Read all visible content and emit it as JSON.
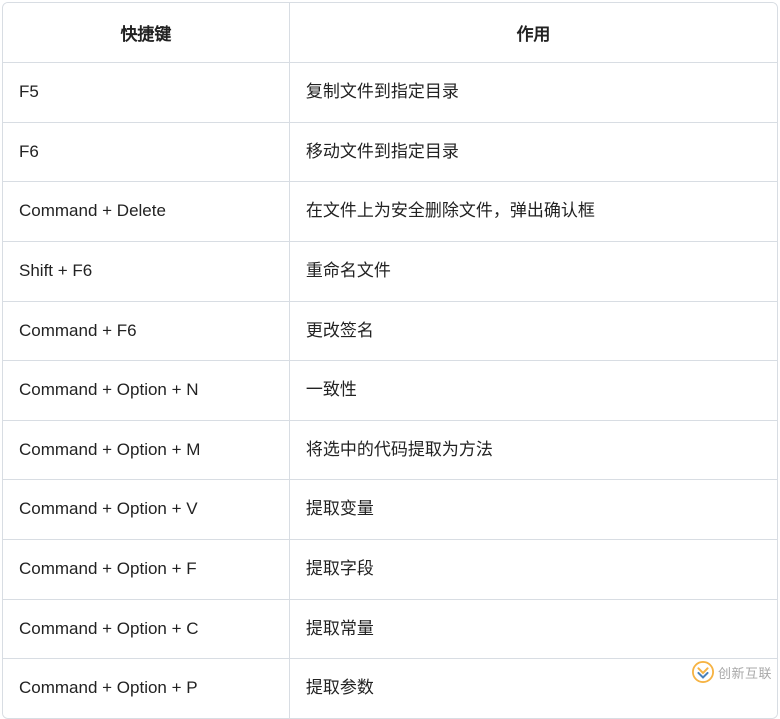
{
  "table": {
    "headers": {
      "shortcut": "快捷键",
      "action": "作用"
    },
    "rows": [
      {
        "shortcut": "F5",
        "action": "复制文件到指定目录"
      },
      {
        "shortcut": "F6",
        "action": "移动文件到指定目录"
      },
      {
        "shortcut": "Command + Delete",
        "action": "在文件上为安全删除文件，弹出确认框"
      },
      {
        "shortcut": "Shift + F6",
        "action": "重命名文件"
      },
      {
        "shortcut": "Command + F6",
        "action": "更改签名"
      },
      {
        "shortcut": "Command + Option + N",
        "action": "一致性"
      },
      {
        "shortcut": "Command + Option + M",
        "action": "将选中的代码提取为方法"
      },
      {
        "shortcut": "Command + Option + V",
        "action": "提取变量"
      },
      {
        "shortcut": "Command + Option + F",
        "action": "提取字段"
      },
      {
        "shortcut": "Command + Option + C",
        "action": "提取常量"
      },
      {
        "shortcut": "Command + Option + P",
        "action": "提取参数"
      }
    ]
  },
  "watermark": {
    "text": "创新互联"
  }
}
